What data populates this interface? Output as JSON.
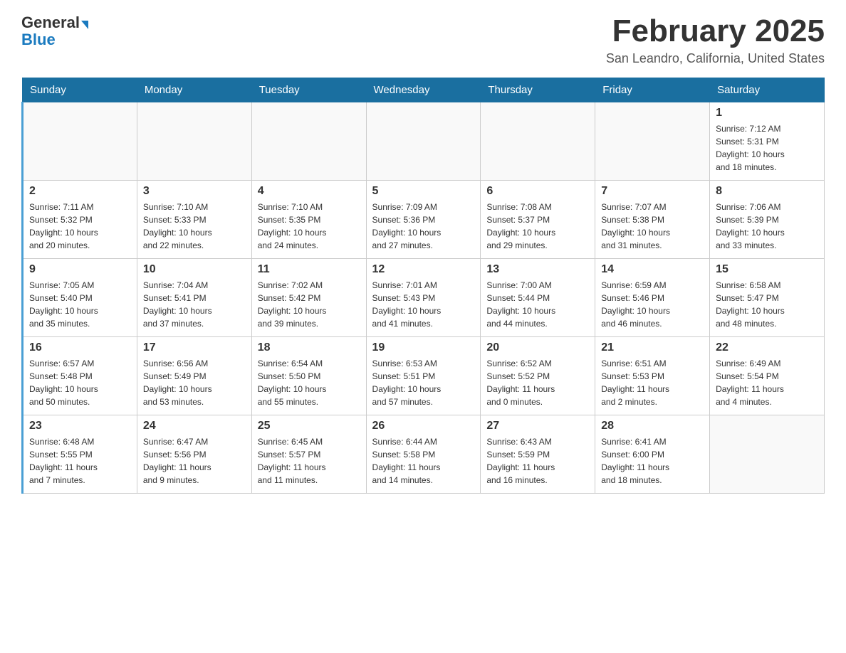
{
  "header": {
    "logo_general": "General",
    "logo_blue": "Blue",
    "month_title": "February 2025",
    "location": "San Leandro, California, United States"
  },
  "days_of_week": [
    "Sunday",
    "Monday",
    "Tuesday",
    "Wednesday",
    "Thursday",
    "Friday",
    "Saturday"
  ],
  "weeks": [
    [
      {
        "day": "",
        "info": ""
      },
      {
        "day": "",
        "info": ""
      },
      {
        "day": "",
        "info": ""
      },
      {
        "day": "",
        "info": ""
      },
      {
        "day": "",
        "info": ""
      },
      {
        "day": "",
        "info": ""
      },
      {
        "day": "1",
        "info": "Sunrise: 7:12 AM\nSunset: 5:31 PM\nDaylight: 10 hours\nand 18 minutes."
      }
    ],
    [
      {
        "day": "2",
        "info": "Sunrise: 7:11 AM\nSunset: 5:32 PM\nDaylight: 10 hours\nand 20 minutes."
      },
      {
        "day": "3",
        "info": "Sunrise: 7:10 AM\nSunset: 5:33 PM\nDaylight: 10 hours\nand 22 minutes."
      },
      {
        "day": "4",
        "info": "Sunrise: 7:10 AM\nSunset: 5:35 PM\nDaylight: 10 hours\nand 24 minutes."
      },
      {
        "day": "5",
        "info": "Sunrise: 7:09 AM\nSunset: 5:36 PM\nDaylight: 10 hours\nand 27 minutes."
      },
      {
        "day": "6",
        "info": "Sunrise: 7:08 AM\nSunset: 5:37 PM\nDaylight: 10 hours\nand 29 minutes."
      },
      {
        "day": "7",
        "info": "Sunrise: 7:07 AM\nSunset: 5:38 PM\nDaylight: 10 hours\nand 31 minutes."
      },
      {
        "day": "8",
        "info": "Sunrise: 7:06 AM\nSunset: 5:39 PM\nDaylight: 10 hours\nand 33 minutes."
      }
    ],
    [
      {
        "day": "9",
        "info": "Sunrise: 7:05 AM\nSunset: 5:40 PM\nDaylight: 10 hours\nand 35 minutes."
      },
      {
        "day": "10",
        "info": "Sunrise: 7:04 AM\nSunset: 5:41 PM\nDaylight: 10 hours\nand 37 minutes."
      },
      {
        "day": "11",
        "info": "Sunrise: 7:02 AM\nSunset: 5:42 PM\nDaylight: 10 hours\nand 39 minutes."
      },
      {
        "day": "12",
        "info": "Sunrise: 7:01 AM\nSunset: 5:43 PM\nDaylight: 10 hours\nand 41 minutes."
      },
      {
        "day": "13",
        "info": "Sunrise: 7:00 AM\nSunset: 5:44 PM\nDaylight: 10 hours\nand 44 minutes."
      },
      {
        "day": "14",
        "info": "Sunrise: 6:59 AM\nSunset: 5:46 PM\nDaylight: 10 hours\nand 46 minutes."
      },
      {
        "day": "15",
        "info": "Sunrise: 6:58 AM\nSunset: 5:47 PM\nDaylight: 10 hours\nand 48 minutes."
      }
    ],
    [
      {
        "day": "16",
        "info": "Sunrise: 6:57 AM\nSunset: 5:48 PM\nDaylight: 10 hours\nand 50 minutes."
      },
      {
        "day": "17",
        "info": "Sunrise: 6:56 AM\nSunset: 5:49 PM\nDaylight: 10 hours\nand 53 minutes."
      },
      {
        "day": "18",
        "info": "Sunrise: 6:54 AM\nSunset: 5:50 PM\nDaylight: 10 hours\nand 55 minutes."
      },
      {
        "day": "19",
        "info": "Sunrise: 6:53 AM\nSunset: 5:51 PM\nDaylight: 10 hours\nand 57 minutes."
      },
      {
        "day": "20",
        "info": "Sunrise: 6:52 AM\nSunset: 5:52 PM\nDaylight: 11 hours\nand 0 minutes."
      },
      {
        "day": "21",
        "info": "Sunrise: 6:51 AM\nSunset: 5:53 PM\nDaylight: 11 hours\nand 2 minutes."
      },
      {
        "day": "22",
        "info": "Sunrise: 6:49 AM\nSunset: 5:54 PM\nDaylight: 11 hours\nand 4 minutes."
      }
    ],
    [
      {
        "day": "23",
        "info": "Sunrise: 6:48 AM\nSunset: 5:55 PM\nDaylight: 11 hours\nand 7 minutes."
      },
      {
        "day": "24",
        "info": "Sunrise: 6:47 AM\nSunset: 5:56 PM\nDaylight: 11 hours\nand 9 minutes."
      },
      {
        "day": "25",
        "info": "Sunrise: 6:45 AM\nSunset: 5:57 PM\nDaylight: 11 hours\nand 11 minutes."
      },
      {
        "day": "26",
        "info": "Sunrise: 6:44 AM\nSunset: 5:58 PM\nDaylight: 11 hours\nand 14 minutes."
      },
      {
        "day": "27",
        "info": "Sunrise: 6:43 AM\nSunset: 5:59 PM\nDaylight: 11 hours\nand 16 minutes."
      },
      {
        "day": "28",
        "info": "Sunrise: 6:41 AM\nSunset: 6:00 PM\nDaylight: 11 hours\nand 18 minutes."
      },
      {
        "day": "",
        "info": ""
      }
    ]
  ]
}
